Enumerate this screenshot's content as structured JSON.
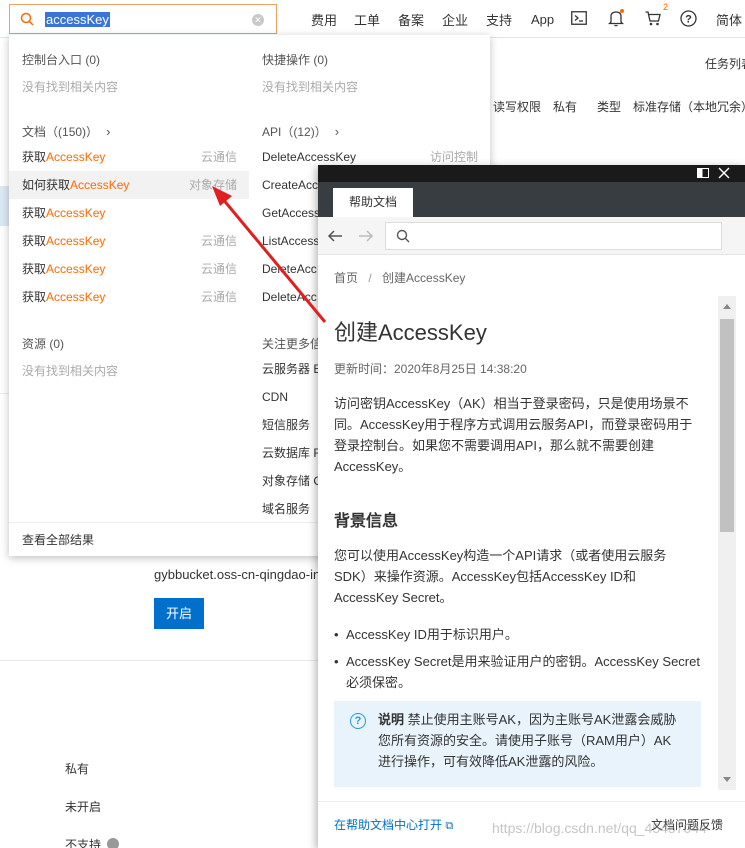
{
  "search": {
    "value": "accessKey"
  },
  "topnav": {
    "items": [
      "费用",
      "工单",
      "备案",
      "企业",
      "支持",
      "App",
      "简体"
    ],
    "cart_badge": "2"
  },
  "background": {
    "task_list": "任务列表",
    "rw_perm_label": "读写权限",
    "rw_perm_value": "私有",
    "type_label": "类型",
    "type_value": "标准存储（本地冗余）",
    "domain": "gybbucket.oss-cn-qingdao-in",
    "enable_button": "开启",
    "row_private": "私有",
    "row_disabled": "未开启",
    "row_unsupported": "不支持"
  },
  "dropdown": {
    "console_entry": {
      "title": "控制台入口",
      "count": "(0)",
      "empty": "没有找到相关内容"
    },
    "quick_ops": {
      "title": "快捷操作",
      "count": "(0)",
      "empty": "没有找到相关内容"
    },
    "docs": {
      "title": "文档",
      "count": "(150)",
      "items": [
        {
          "prefix": "获取",
          "hl": "AccessKey",
          "tag": "云通信"
        },
        {
          "prefix": "如何获取",
          "hl": "AccessKey",
          "tag": "对象存储"
        },
        {
          "prefix": "获取",
          "hl": "AccessKey",
          "tag": ""
        },
        {
          "prefix": "获取",
          "hl": "AccessKey",
          "tag": "云通信"
        },
        {
          "prefix": "获取",
          "hl": "AccessKey",
          "tag": "云通信"
        },
        {
          "prefix": "获取",
          "hl": "AccessKey",
          "tag": "云通信"
        }
      ]
    },
    "api": {
      "title": "API",
      "count": "(12)",
      "items": [
        {
          "label": "DeleteAccessKey",
          "tag": "访问控制"
        },
        {
          "label": "CreateAcc",
          "tag": ""
        },
        {
          "label": "GetAccess",
          "tag": ""
        },
        {
          "label": "ListAccess",
          "tag": ""
        },
        {
          "label": "DeleteAcc",
          "tag": ""
        },
        {
          "label": "DeleteAcc",
          "tag": ""
        }
      ]
    },
    "resources": {
      "title": "资源",
      "count": "(0)",
      "empty": "没有找到相关内容"
    },
    "follow": {
      "title": "关注更多信",
      "items": [
        "云服务器 E",
        "CDN",
        "短信服务",
        "云数据库 R",
        "对象存储 C",
        "域名服务"
      ]
    },
    "view_all": "查看全部结果"
  },
  "help_panel": {
    "tab": "帮助文档",
    "breadcrumb_home": "首页",
    "breadcrumb_sep": "/",
    "breadcrumb_current": "创建AccessKey",
    "title": "创建AccessKey",
    "updated": "更新时间：2020年8月25日 14:38:20",
    "intro": "访问密钥AccessKey（AK）相当于登录密码，只是使用场景不同。AccessKey用于程序方式调用云服务API，而登录密码用于登录控制台。如果您不需要调用API，那么就不需要创建AccessKey。",
    "bg_heading": "背景信息",
    "bg_para": "您可以使用AccessKey构造一个API请求（或者使用云服务SDK）来操作资源。AccessKey包括AccessKey ID和AccessKey Secret。",
    "bullet_1": "AccessKey ID用于标识用户。",
    "bullet_2": "AccessKey Secret是用来验证用户的密钥。AccessKey Secret必须保密。",
    "note_label": "说明",
    "note_text": "禁止使用主账号AK，因为主账号AK泄露会威胁您所有资源的安全。请使用子账号（RAM用户）AK进行操作，可有效降低AK泄露的风险。",
    "open_in_center": "在帮助文档中心打开",
    "feedback": "文档问题反馈"
  },
  "watermark": "https://blog.csdn.net/qq_45457044",
  "colors": {
    "accent_orange": "#ff6a00",
    "brand_blue": "#0070cc",
    "arrow_red": "#e02020"
  }
}
